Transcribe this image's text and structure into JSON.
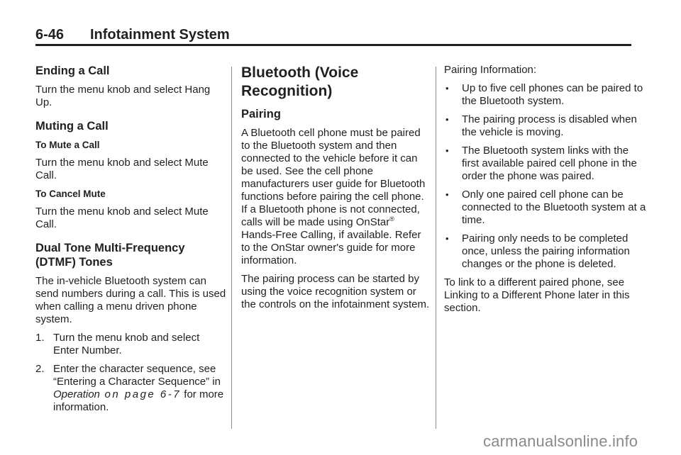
{
  "header": {
    "page_number": "6-46",
    "section_title": "Infotainment System"
  },
  "column1": {
    "ending_call": {
      "heading": "Ending a Call",
      "body": "Turn the menu knob and select Hang Up."
    },
    "muting_call": {
      "heading": "Muting a Call",
      "to_mute": {
        "subheading": "To Mute a Call",
        "body": "Turn the menu knob and select Mute Call."
      },
      "to_cancel": {
        "subheading": "To Cancel Mute",
        "body": "Turn the menu knob and select Mute Call."
      }
    },
    "dtmf": {
      "heading": "Dual Tone Multi-Frequency (DTMF) Tones",
      "body": "The in-vehicle Bluetooth system can send numbers during a call. This is used when calling a menu driven phone system.",
      "steps": [
        {
          "marker": "1.",
          "text": "Turn the menu knob and select Enter Number."
        },
        {
          "marker": "2.",
          "text_before": "Enter the character sequence, see “Entering a Character Sequence” in ",
          "link_italic": "Operation",
          "link_spaced": " on page 6-7",
          "text_after": " for more information."
        }
      ]
    }
  },
  "column2": {
    "title": "Bluetooth (Voice Recognition)",
    "pairing": {
      "heading": "Pairing",
      "para1_part1": "A Bluetooth cell phone must be paired to the Bluetooth system and then connected to the vehicle before it can be used. See the cell phone manufacturers user guide for Bluetooth functions before pairing the cell phone. If a Bluetooth phone is not connected, calls will be made using OnStar",
      "para1_sup": "®",
      "para1_part2": " Hands-Free Calling, if available. Refer to the OnStar owner's guide for more information.",
      "para2": "The pairing process can be started by using the voice recognition system or the controls on the infotainment system."
    }
  },
  "column3": {
    "intro": "Pairing Information:",
    "bullet_marker": "•",
    "bullets": [
      "Up to five cell phones can be paired to the Bluetooth system.",
      "The pairing process is disabled when the vehicle is moving.",
      "The Bluetooth system links with the first available paired cell phone in the order the phone was paired.",
      "Only one paired cell phone can be connected to the Bluetooth system at a time.",
      "Pairing only needs to be completed once, unless the pairing information changes or the phone is deleted."
    ],
    "closing": "To link to a different paired phone, see Linking to a Different Phone later in this section."
  },
  "watermark": "carmanualsonline.info"
}
